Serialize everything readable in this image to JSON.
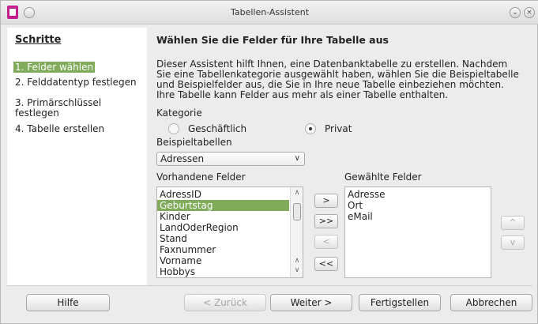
{
  "window": {
    "title": "Tabellen-Assistent"
  },
  "steps": {
    "title": "Schritte",
    "items": [
      {
        "label": "1. Felder wählen"
      },
      {
        "label": "2. Felddatentyp festlegen"
      },
      {
        "label": "3. Primärschlüssel"
      },
      {
        "label": "festlegen"
      },
      {
        "label": "4. Tabelle erstellen"
      }
    ]
  },
  "main": {
    "heading": "Wählen Sie die Felder für Ihre Tabelle aus",
    "description": "Dieser Assistent hilft Ihnen, eine Datenbanktabelle zu erstellen. Nachdem Sie eine Tabellenkategorie ausgewählt haben, wählen Sie die Beispieltabelle und Beispielfelder aus, die Sie in Ihre neue Tabelle einbeziehen möchten. Ihre Tabelle kann Felder aus mehr als einer Tabelle enthalten.",
    "category_label": "Kategorie",
    "category_options": {
      "business": "Geschäftlich",
      "private": "Privat"
    },
    "sample_tables_label": "Beispieltabellen",
    "sample_table_value": "Adressen",
    "available_fields_label": "Vorhandene Felder",
    "selected_fields_label": "Gewählte Felder",
    "available_fields": [
      "AdressID",
      "Geburtstag",
      "Kinder",
      "LandOderRegion",
      "Stand",
      "Faxnummer",
      "Vorname",
      "Hobbys"
    ],
    "selected_fields": [
      "Adresse",
      "Ort",
      "eMail"
    ],
    "move_buttons": {
      "add": ">",
      "add_all": ">>",
      "remove": "<",
      "remove_all": "<<"
    },
    "order_buttons": {
      "up": "^",
      "down": "v"
    }
  },
  "footer": {
    "help": "Hilfe",
    "back": "< Zurück",
    "next": "Weiter >",
    "finish": "Fertigstellen",
    "cancel": "Abbrechen"
  }
}
